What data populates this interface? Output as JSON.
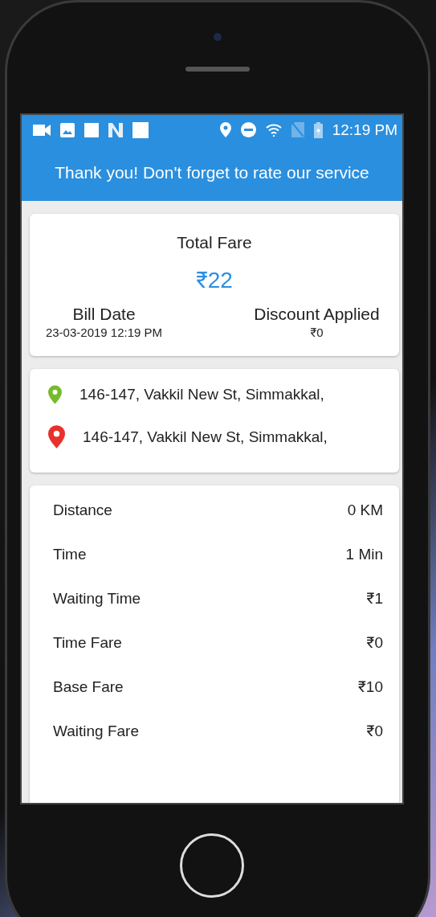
{
  "status_bar": {
    "time": "12:19 PM"
  },
  "app_bar": {
    "title": "Thank you! Don't forget to rate our service"
  },
  "fare_summary": {
    "title": "Total Fare",
    "amount": "₹22",
    "bill_date_label": "Bill Date",
    "bill_date": "23-03-2019 12:19 PM",
    "discount_label": "Discount Applied",
    "discount": "₹0"
  },
  "locations": [
    {
      "address": "146-147, Vakkil New St, Simmakkal,",
      "color": "#76bb2a"
    },
    {
      "address": "146-147, Vakkil New St, Simmakkal,",
      "color": "#e8302c"
    }
  ],
  "fare_details": [
    {
      "label": "Distance",
      "value": "0 KM"
    },
    {
      "label": "Time",
      "value": "1 Min"
    },
    {
      "label": "Waiting Time",
      "value": "₹1"
    },
    {
      "label": "Time Fare",
      "value": "₹0"
    },
    {
      "label": "Base Fare",
      "value": "₹10"
    },
    {
      "label": "Waiting Fare",
      "value": "₹0"
    }
  ]
}
